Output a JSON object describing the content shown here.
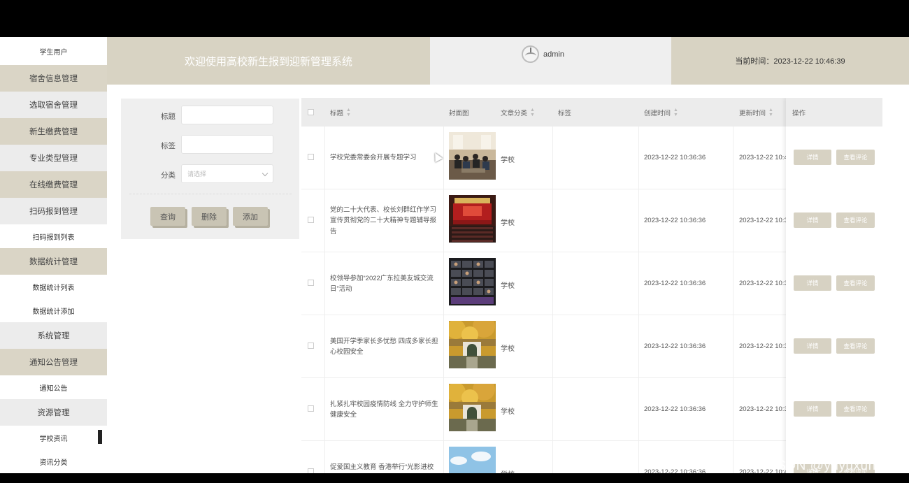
{
  "sidebar": {
    "items": [
      {
        "label": "学生用户"
      },
      {
        "label": "宿舍信息管理"
      },
      {
        "label": "选取宿舍管理"
      },
      {
        "label": "新生缴费管理"
      },
      {
        "label": "专业类型管理"
      },
      {
        "label": "在线缴费管理"
      },
      {
        "label": "扫码报到管理"
      },
      {
        "label": "扫码报到列表"
      },
      {
        "label": "数据统计管理"
      },
      {
        "label": "数据统计列表"
      },
      {
        "label": "数据统计添加"
      },
      {
        "label": "系统管理"
      },
      {
        "label": "通知公告管理"
      },
      {
        "label": "通知公告"
      },
      {
        "label": "资源管理"
      },
      {
        "label": "学校资讯"
      },
      {
        "label": "资讯分类"
      }
    ]
  },
  "header": {
    "title": "欢迎使用高校新生报到迎新管理系统",
    "username": "admin",
    "time": "当前时间：2023-12-22 10:46:39"
  },
  "search": {
    "title_label": "标题",
    "tag_label": "标签",
    "category_label": "分类",
    "category_placeholder": "请选择",
    "query_button": "查询",
    "delete_button": "删除",
    "add_button": "添加"
  },
  "table": {
    "headers": {
      "title": "标题",
      "cover": "封面图",
      "category": "文章分类",
      "tags": "标签",
      "created": "创建时间",
      "updated": "更新时间",
      "actions": "操作"
    },
    "detail_button": "详情",
    "comments_button": "查看评论",
    "rows": [
      {
        "title": "学校党委常委会开展专题学习",
        "category": "学校",
        "created": "2023-12-22 10:36:36",
        "updated": "2023-12-22 10:4",
        "thumb": "meeting"
      },
      {
        "title": "党的二十大代表、校长刘群红作学习宣传贯彻党的二十大精神专题辅导报告",
        "category": "学校",
        "created": "2023-12-22 10:36:36",
        "updated": "2023-12-22 10:3",
        "thumb": "auditorium"
      },
      {
        "title": "校领导参加“2022广东拉美友城交流日”活动",
        "category": "学校",
        "created": "2023-12-22 10:36:36",
        "updated": "2023-12-22 10:3",
        "thumb": "video-call"
      },
      {
        "title": "美国开学季家长多忧愁 四成多家长担心校园安全",
        "category": "学校",
        "created": "2023-12-22 10:36:36",
        "updated": "2023-12-22 10:3",
        "thumb": "campus-gate"
      },
      {
        "title": "扎紧扎牢校园疫情防线 全力守护师生健康安全",
        "category": "学校",
        "created": "2023-12-22 10:36:36",
        "updated": "2023-12-22 10:3",
        "thumb": "campus-gate"
      },
      {
        "title": "促爱国主义教育 香港举行“光影进校",
        "category": "学校",
        "created": "2023-12-22 10:36:36",
        "updated": "2023-12-22 10:4",
        "thumb": "sky"
      }
    ]
  },
  "watermark": "CSDN @yuyuxun1"
}
